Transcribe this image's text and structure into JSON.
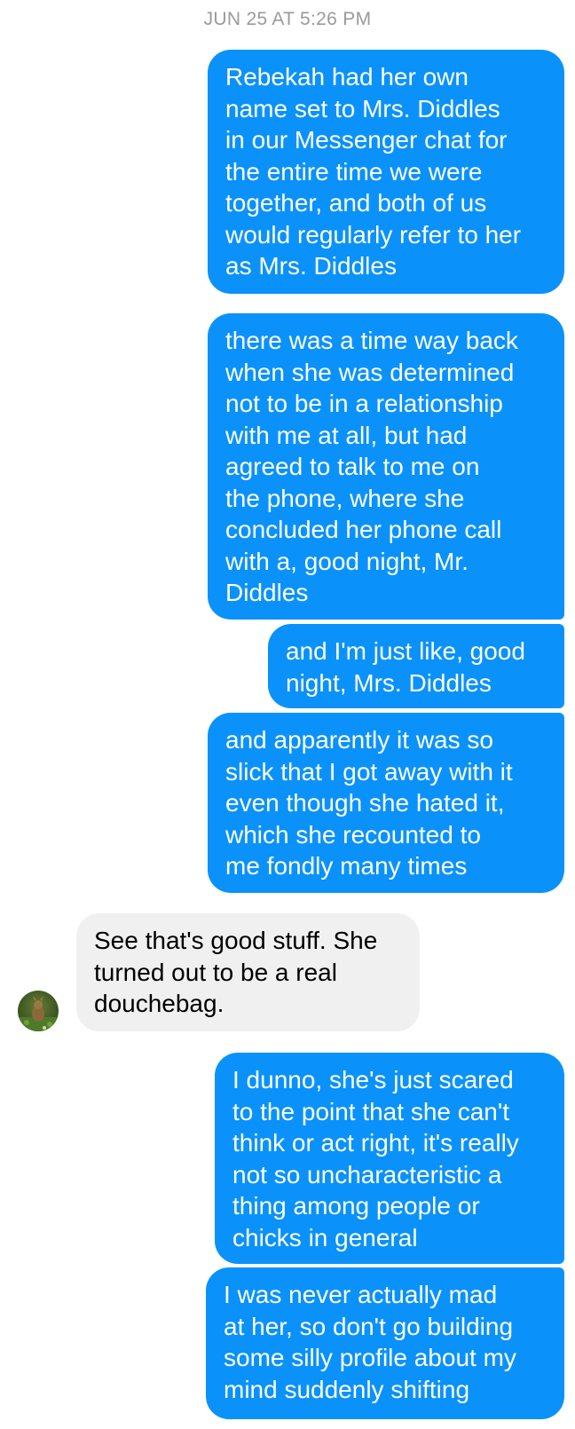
{
  "thread": {
    "timestamp": "JUN 25 AT 5:26 PM",
    "messages": [
      {
        "sender": "me",
        "text": "Rebekah had her own\nname set to Mrs. Diddles\nin our Messenger chat for\nthe entire time we were\ntogether, and both of us\nwould regularly refer to her\nas Mrs. Diddles"
      },
      {
        "sender": "me",
        "text": "there was a time way back\nwhen she was determined\nnot to be in a relationship\nwith me at all, but had\nagreed to talk to me on\nthe phone, where she\nconcluded her phone call\nwith a, good night, Mr.\nDiddles"
      },
      {
        "sender": "me",
        "text": "and I'm just like, good\nnight, Mrs. Diddles"
      },
      {
        "sender": "me",
        "text": "and apparently it was so\nslick that I got away with it\neven though she hated it,\nwhich she recounted to\nme fondly many times"
      },
      {
        "sender": "them",
        "text": "See that's good stuff. She\nturned out to be a real\ndouchebag."
      },
      {
        "sender": "me",
        "text": "I dunno, she's just scared\nto the point that she can't\nthink or act right, it's really\nnot so uncharacteristic a\nthing among people or\nchicks in general"
      },
      {
        "sender": "me",
        "text": "I was never actually mad\nat her, so don't go building\nsome silly profile about my\nmind suddenly shifting"
      }
    ]
  },
  "colors": {
    "outgoing_bubble": "#0a92fa",
    "incoming_bubble": "#f1f0f0",
    "timestamp_text": "#9a9a9a"
  },
  "icons": {
    "avatar": "contact-avatar"
  }
}
